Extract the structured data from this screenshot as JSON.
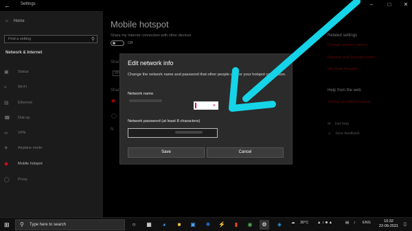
{
  "window": {
    "app_title": "Settings",
    "back_icon": "back-arrow-icon",
    "controls": [
      "minimize-icon",
      "maximize-icon",
      "close-icon"
    ]
  },
  "sidebar": {
    "home_label": "Home",
    "search_placeholder": "Find a setting",
    "section_title": "Network & Internet",
    "items": [
      {
        "label": "Status",
        "icon": "status-icon"
      },
      {
        "label": "Wi-Fi",
        "icon": "wifi-icon"
      },
      {
        "label": "Ethernet",
        "icon": "ethernet-icon"
      },
      {
        "label": "Dial-up",
        "icon": "dialup-icon"
      },
      {
        "label": "VPN",
        "icon": "vpn-icon"
      },
      {
        "label": "Airplane mode",
        "icon": "airplane-icon"
      },
      {
        "label": "Mobile hotspot",
        "icon": "hotspot-icon"
      },
      {
        "label": "Proxy",
        "icon": "proxy-icon"
      }
    ]
  },
  "main": {
    "title": "Mobile hotspot",
    "share_label": "Share my Internet connection with other devices",
    "toggle_state": "Off",
    "ghost_share": "Shar",
    "ghost_wi": "Wi",
    "ghost_share2": "Share",
    "ghost_n": "N"
  },
  "related": {
    "heading": "Related settings",
    "links": [
      "Change adapter options",
      "Network and Sharing Center",
      "Windows Firewall"
    ],
    "help_heading": "Help from the web",
    "help_link": "Setting up mobile hotspot",
    "get_help": "Get help",
    "give_feedback": "Give feedback"
  },
  "dialog": {
    "title": "Edit network info",
    "description": "Change the network name and password that other people use for your hotspot connection.",
    "name_label": "Network name",
    "password_label": "Network password (at least 8 characters)",
    "save_label": "Save",
    "cancel_label": "Cancel"
  },
  "taskbar": {
    "search_placeholder": "Type here to search",
    "weather": "30°C",
    "lang": "ENG",
    "time": "10:32",
    "date": "22-09-2021"
  },
  "colors": {
    "accent": "#e81123",
    "arrow": "#16d4e8"
  }
}
